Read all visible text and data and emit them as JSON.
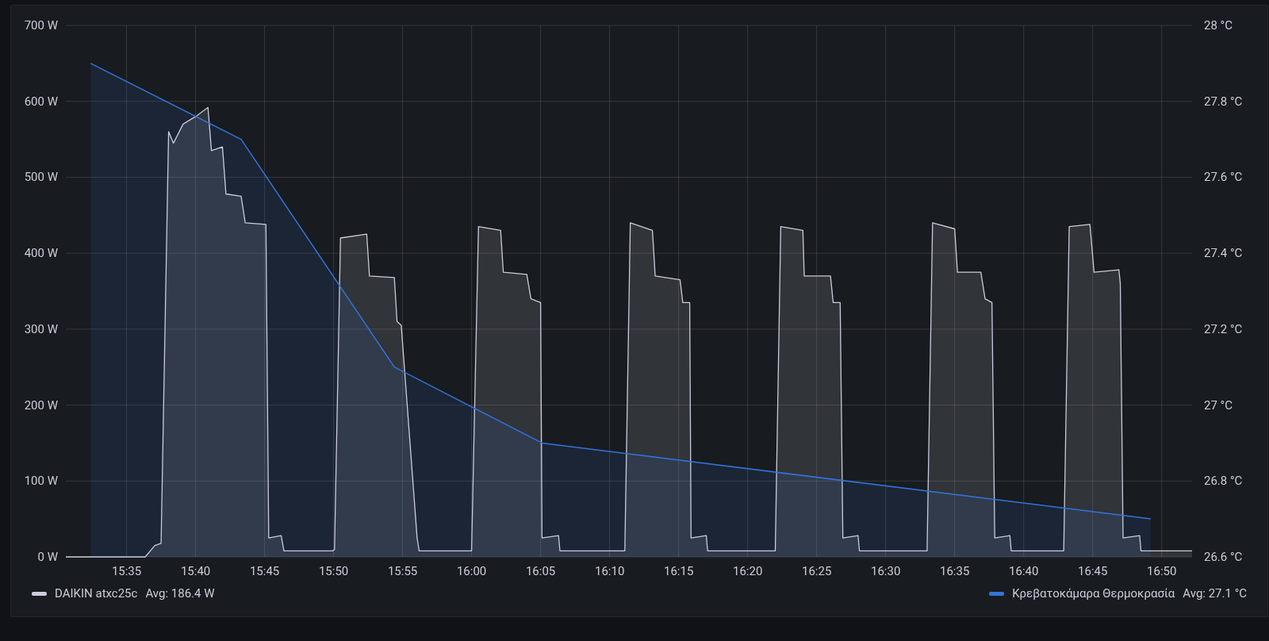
{
  "panel": {
    "chart_data": {
      "type": "area",
      "grid": true,
      "xlim": [
        930.6,
        1012.2
      ],
      "ylim": [
        0,
        700
      ],
      "y2lim": [
        26.6,
        28
      ],
      "xticks": [
        {
          "value": 935,
          "label": "15:35"
        },
        {
          "value": 940,
          "label": "15:40"
        },
        {
          "value": 945,
          "label": "15:45"
        },
        {
          "value": 950,
          "label": "15:50"
        },
        {
          "value": 955,
          "label": "15:55"
        },
        {
          "value": 960,
          "label": "16:00"
        },
        {
          "value": 965,
          "label": "16:05"
        },
        {
          "value": 970,
          "label": "16:10"
        },
        {
          "value": 975,
          "label": "16:15"
        },
        {
          "value": 980,
          "label": "16:20"
        },
        {
          "value": 985,
          "label": "16:25"
        },
        {
          "value": 990,
          "label": "16:30"
        },
        {
          "value": 995,
          "label": "16:35"
        },
        {
          "value": 1000,
          "label": "16:40"
        },
        {
          "value": 1005,
          "label": "16:45"
        },
        {
          "value": 1010,
          "label": "16:50"
        }
      ],
      "yticks": [
        {
          "value": 0,
          "label": "0 W"
        },
        {
          "value": 100,
          "label": "100 W"
        },
        {
          "value": 200,
          "label": "200 W"
        },
        {
          "value": 300,
          "label": "300 W"
        },
        {
          "value": 400,
          "label": "400 W"
        },
        {
          "value": 500,
          "label": "500 W"
        },
        {
          "value": 600,
          "label": "600 W"
        },
        {
          "value": 700,
          "label": "700 W"
        }
      ],
      "y2ticks": [
        {
          "value": 26.6,
          "label": "26.6 °C"
        },
        {
          "value": 26.8,
          "label": "26.8 °C"
        },
        {
          "value": 27,
          "label": "27 °C"
        },
        {
          "value": 27.2,
          "label": "27.2 °C"
        },
        {
          "value": 27.4,
          "label": "27.4 °C"
        },
        {
          "value": 27.6,
          "label": "27.6 °C"
        },
        {
          "value": 27.8,
          "label": "27.8 °C"
        },
        {
          "value": 28,
          "label": "28 °C"
        }
      ],
      "series": [
        {
          "name": "DAIKIN atxc25c",
          "color": "#ccccdc",
          "x": [
            930.6,
            936.35,
            937.05,
            937.5,
            938.05,
            938.4,
            939.1,
            940.0,
            940.9,
            941.15,
            941.95,
            942.2,
            943.3,
            943.6,
            945.1,
            945.3,
            946.2,
            946.4,
            949.95,
            950.07,
            950.5,
            952.4,
            952.6,
            954.4,
            954.6,
            954.9,
            956.05,
            956.2,
            960.0,
            960.5,
            962.1,
            962.3,
            964.0,
            964.3,
            965.0,
            965.1,
            966.3,
            966.4,
            971.1,
            971.5,
            973.1,
            973.3,
            975.1,
            975.3,
            975.8,
            975.9,
            977.0,
            977.1,
            982.0,
            982.4,
            984.0,
            984.1,
            986.0,
            986.2,
            986.7,
            986.9,
            988.0,
            988.1,
            993.0,
            993.4,
            995.0,
            995.2,
            996.9,
            997.2,
            997.7,
            997.9,
            999.0,
            999.1,
            1002.9,
            1003.3,
            1004.8,
            1005.1,
            1006.9,
            1007.0,
            1007.2,
            1008.4,
            1008.5,
            1012.2
          ],
          "values": [
            0,
            0,
            15,
            18,
            560,
            545,
            570,
            580,
            592,
            535,
            540,
            478,
            475,
            440,
            438,
            25,
            28,
            8,
            8,
            10,
            420,
            425,
            370,
            368,
            310,
            305,
            25,
            8,
            8,
            435,
            430,
            375,
            372,
            340,
            335,
            25,
            28,
            8,
            8,
            440,
            430,
            370,
            365,
            335,
            335,
            25,
            28,
            8,
            8,
            435,
            430,
            370,
            370,
            335,
            335,
            25,
            28,
            8,
            8,
            440,
            432,
            375,
            375,
            340,
            335,
            25,
            28,
            8,
            8,
            435,
            438,
            375,
            378,
            360,
            25,
            28,
            8,
            8
          ]
        },
        {
          "name": "Κρεβατοκάμαρα Θερμοκρασία",
          "color": "#3274d9",
          "axis": "y2",
          "x": [
            932.4,
            943.3,
            954.4,
            965.1,
            1009.2
          ],
          "values": [
            27.9,
            27.7,
            27.1,
            26.9,
            26.7
          ]
        }
      ]
    },
    "legend": [
      {
        "value": "Avg: 186.4 W"
      },
      {
        "value": "Avg: 27.1 °C"
      }
    ]
  }
}
